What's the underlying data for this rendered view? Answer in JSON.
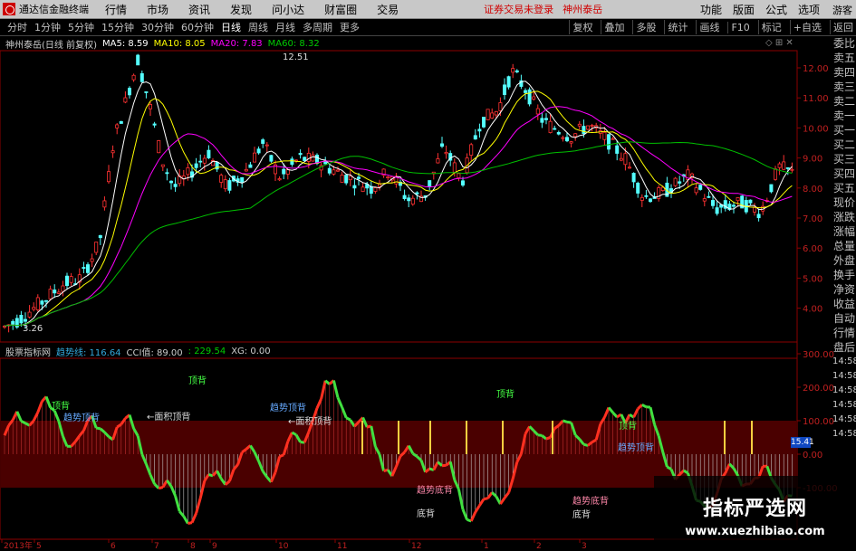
{
  "app": {
    "name": "通达信金融终端",
    "menu": [
      "行情",
      "市场",
      "资讯",
      "发现",
      "问小达",
      "财富圈",
      "交易"
    ],
    "notice1": "证券交易未登录",
    "notice2": "神州泰岳",
    "right_menu": [
      "功能",
      "版面",
      "公式",
      "选项"
    ],
    "guest": "游客"
  },
  "toolbar": {
    "periods": [
      "分时",
      "1分钟",
      "5分钟",
      "15分钟",
      "30分钟",
      "60分钟",
      "日线",
      "周线",
      "月线",
      "多周期",
      "更多"
    ],
    "active": "日线",
    "right": [
      "复权",
      "叠加",
      "多股",
      "统计",
      "画线",
      "F10",
      "标记",
      "+自选",
      "返回"
    ]
  },
  "info": {
    "stock": "神州泰岳(日线 前复权)",
    "ma5": "MA5: 8.59",
    "ma10": "MA10: 8.05",
    "ma20": "MA20: 7.83",
    "ma60": "MA60: 8.32"
  },
  "price_axis": [
    "12.00",
    "11.00",
    "10.00",
    "9.00",
    "8.00",
    "7.00",
    "6.00",
    "5.00",
    "4.00"
  ],
  "annotations": {
    "high": "12.51",
    "low": "3.26"
  },
  "indicator": {
    "name": "股票指标网",
    "trend": "趋势线: 116.64",
    "cci": "CCI值: 89.00",
    "v3": ": 229.54",
    "xg": "XG: 0.00",
    "current": "15.41"
  },
  "ind_axis": [
    "300.00",
    "200.00",
    "100.00",
    "0.00",
    "-100.00"
  ],
  "ind_labels": {
    "jinbei1": "顶背",
    "jinbei2": "顶背",
    "trend1": "趋势顶背",
    "area1": "←面积顶背",
    "trend2": "趋势顶背",
    "area2": "←面积顶背",
    "dibei1": "趋势底背",
    "dibei2": "底背",
    "dingbei3": "顶背",
    "trend3": "趋势顶背",
    "dibei3": "趋势底背",
    "dibei4": "底背",
    "dingbei4": "顶背"
  },
  "x_axis": [
    "2013年",
    "5",
    "6",
    "7",
    "8",
    "9",
    "10",
    "11",
    "12",
    "1",
    "2",
    "3"
  ],
  "side_right": [
    "委比",
    "卖五",
    "卖四",
    "卖三",
    "卖二",
    "卖一",
    "买一",
    "买二",
    "买三",
    "买四",
    "买五",
    "现价",
    "涨跌",
    "涨幅",
    "总量",
    "外盘",
    "换手",
    "净资",
    "收益",
    "自动",
    "行情",
    "盘后"
  ],
  "side_times": [
    "14:58",
    "14:58",
    "14:58",
    "14:58",
    "14:58",
    "14:58"
  ],
  "watermark": {
    "title": "指标严选网",
    "url": "www.xuezhibiao.com"
  },
  "colors": {
    "up": "#ff3232",
    "down": "#54ffff",
    "ma5": "#ffffff",
    "ma10": "#ffff00",
    "ma20": "#ff00ff",
    "ma60": "#00c000",
    "cci_up": "#ff3020",
    "cci_down": "#40e040"
  }
}
